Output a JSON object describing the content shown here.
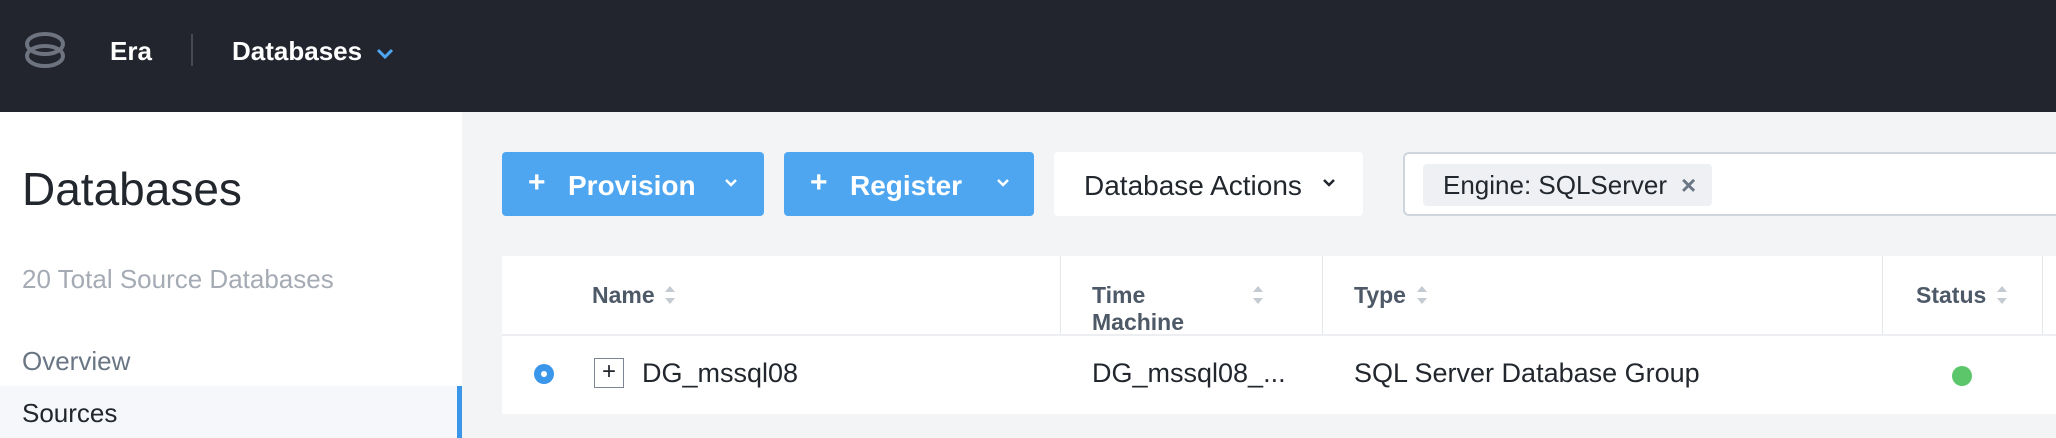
{
  "header": {
    "app_name": "Era",
    "section": "Databases"
  },
  "sidebar": {
    "title": "Databases",
    "count_text": "20 Total Source Databases",
    "items": [
      {
        "label": "Overview",
        "active": false
      },
      {
        "label": "Sources",
        "active": true
      }
    ]
  },
  "toolbar": {
    "provision_label": "Provision",
    "register_label": "Register",
    "actions_label": "Database Actions",
    "filter_chip": "Engine: SQLServer",
    "filter_remove": "×"
  },
  "table": {
    "columns": [
      "Name",
      "Time Machine",
      "Type",
      "Status"
    ],
    "rows": [
      {
        "name": "DG_mssql08",
        "time_machine": "DG_mssql08_...",
        "type": "SQL Server Database Group",
        "status": "healthy",
        "selected": true,
        "expand_symbol": "+"
      }
    ]
  },
  "colors": {
    "topbar": "#22252e",
    "accent": "#4ea6f0",
    "status_ok": "#5cc76a"
  }
}
